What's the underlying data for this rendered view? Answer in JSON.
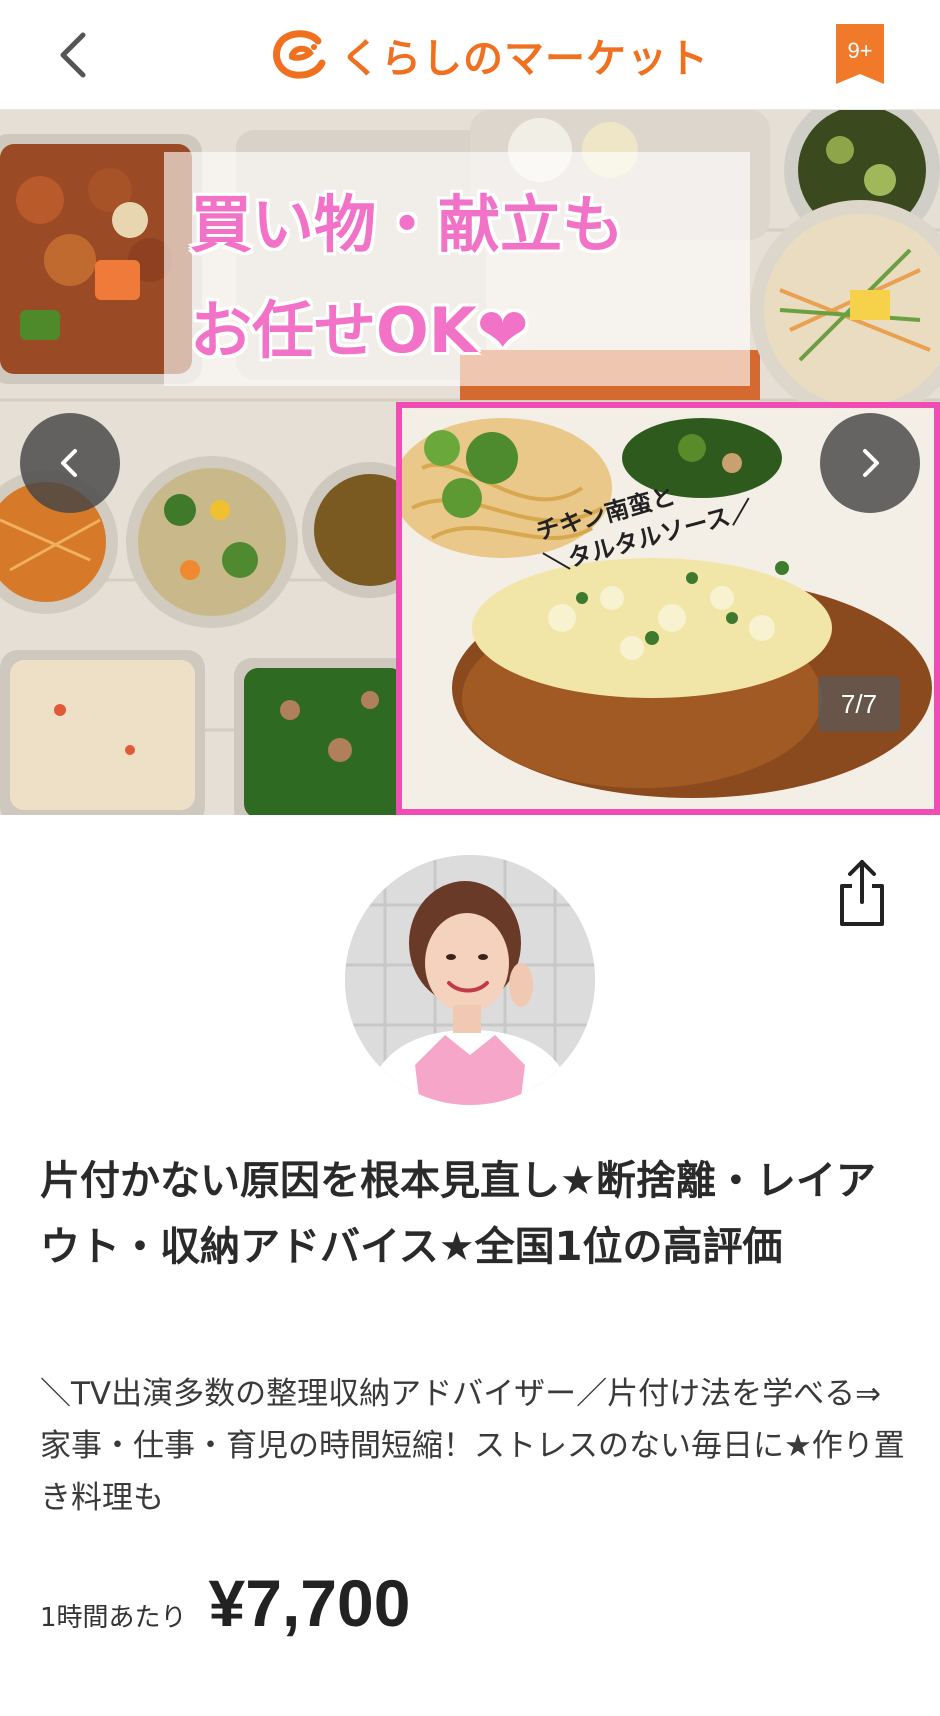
{
  "header": {
    "logo_text": "くらしのマーケット",
    "notification_count": "9+",
    "icons": {
      "back": "chevron-left-icon",
      "logo": "kurashi-logo-icon",
      "notification": "bookmark-badge-icon"
    },
    "brand_color": "#f07020"
  },
  "carousel": {
    "banner_line1": "買い物・献立も",
    "banner_line2": "お任せOK❤",
    "inset_caption_line1": "チキン南蛮と",
    "inset_caption_line2": "＼タルタルソース／",
    "counter": "7/7",
    "current_slide": 7,
    "total_slides": 7,
    "accent_color": "#f04cb4",
    "icons": {
      "prev": "chevron-left-icon",
      "next": "chevron-right-icon"
    }
  },
  "profile": {
    "icons": {
      "share": "share-icon",
      "avatar": "avatar-photo"
    }
  },
  "listing": {
    "title": "片付かない原因を根本見直し★断捨離・レイアウト・収納アドバイス★全国1位の高評価",
    "description": "＼TV出演多数の整理収納アドバイザー／片付け法を学べる⇒家事・仕事・育児の時間短縮！ストレスのない毎日に★作り置き料理も",
    "price_unit": "1時間あたり",
    "price": "¥7,700"
  }
}
